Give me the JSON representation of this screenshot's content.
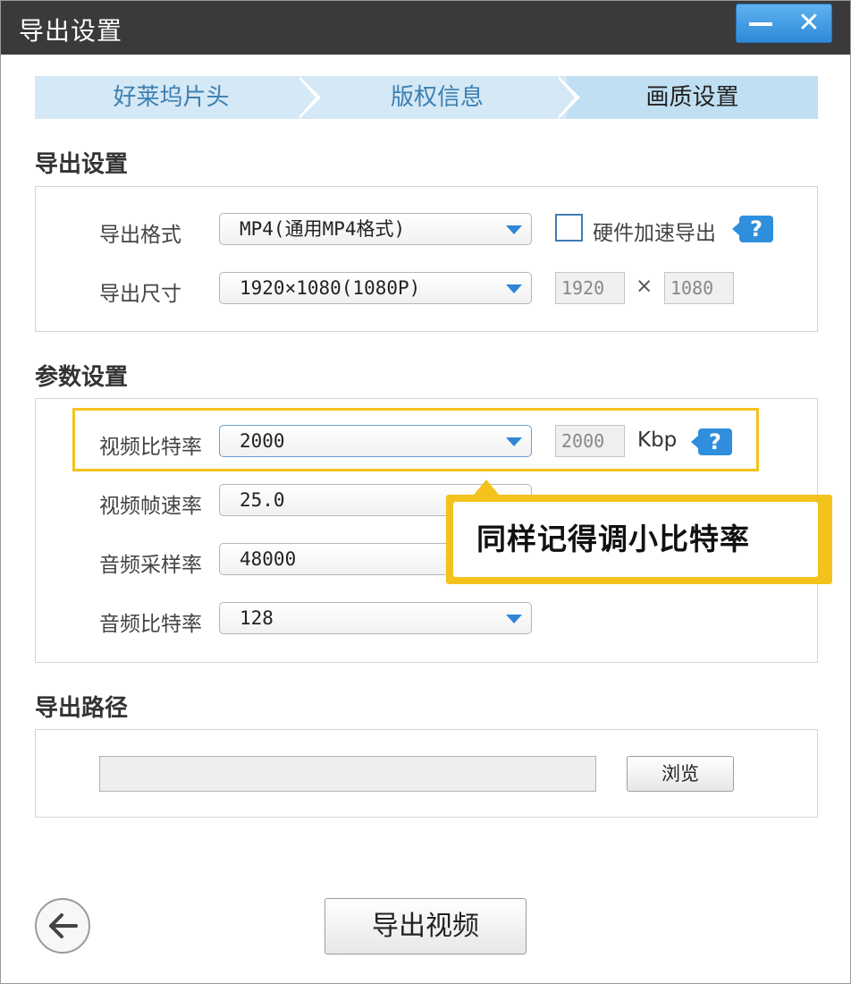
{
  "window": {
    "title": "导出设置"
  },
  "steps": [
    {
      "label": "好莱坞片头"
    },
    {
      "label": "版权信息"
    },
    {
      "label": "画质设置"
    }
  ],
  "export_settings": {
    "section_title": "导出设置",
    "format_label": "导出格式",
    "format_value": "MP4(通用MP4格式)",
    "hw_accel_label": "硬件加速导出",
    "hw_accel_checked": false,
    "size_label": "导出尺寸",
    "size_value": "1920×1080(1080P)",
    "width": "1920",
    "times": "×",
    "height": "1080"
  },
  "params": {
    "section_title": "参数设置",
    "video_bitrate_label": "视频比特率",
    "video_bitrate_value": "2000",
    "video_bitrate_box": "2000",
    "bitrate_unit": "Kbp",
    "framerate_label": "视频帧速率",
    "framerate_value": "25.0",
    "sample_rate_label": "音频采样率",
    "sample_rate_value": "48000",
    "audio_bitrate_label": "音频比特率",
    "audio_bitrate_value": "128"
  },
  "callout": {
    "text": "同样记得调小比特率"
  },
  "help_glyph": "?",
  "output": {
    "section_title": "导出路径",
    "path_value": "",
    "browse_label": "浏览"
  },
  "buttons": {
    "export_label": "导出视频",
    "close_glyph": "✕",
    "back_glyph": "←"
  },
  "colors": {
    "accent": "#2f8fdc",
    "highlight": "#f4c21c",
    "titlebar": "#3a3a3a"
  }
}
